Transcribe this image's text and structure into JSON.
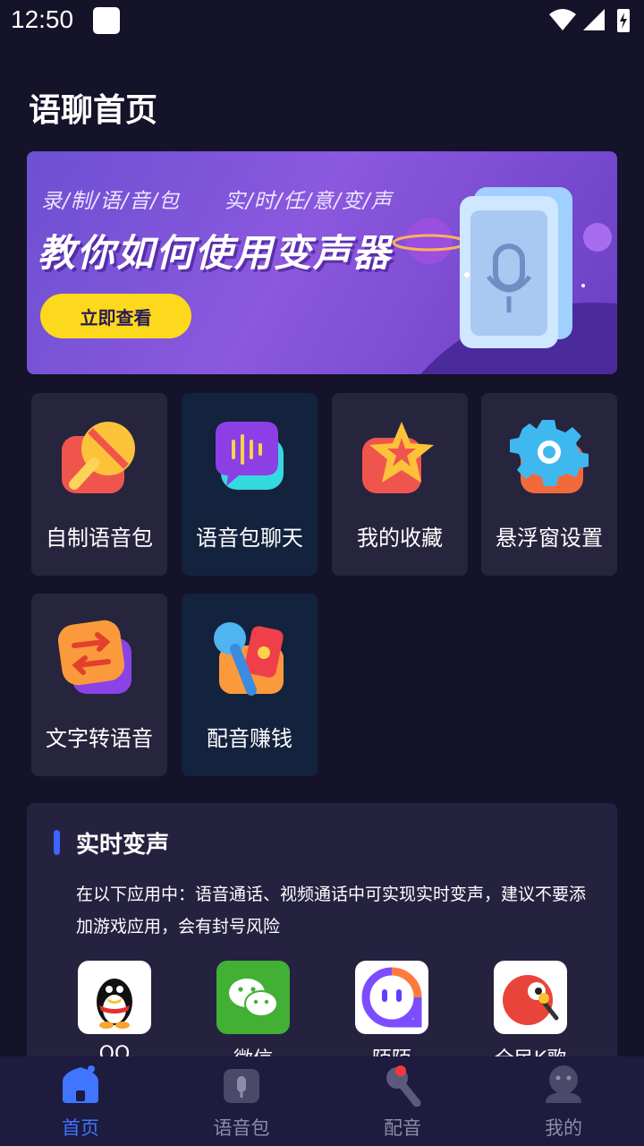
{
  "status_bar": {
    "time": "12:50"
  },
  "page": {
    "title": "语聊首页"
  },
  "banner": {
    "subtitle": "录/制/语/音/包      实/时/任/意/变/声",
    "headline": "教你如何使用变声器",
    "button_label": "立即查看"
  },
  "features": [
    {
      "label": "自制语音包",
      "icon": "microphone-icon"
    },
    {
      "label": "语音包聊天",
      "icon": "voice-chat-icon"
    },
    {
      "label": "我的收藏",
      "icon": "star-icon"
    },
    {
      "label": "悬浮窗设置",
      "icon": "gear-icon"
    },
    {
      "label": "文字转语音",
      "icon": "convert-icon"
    },
    {
      "label": "配音赚钱",
      "icon": "mic-redpacket-icon"
    }
  ],
  "realtime": {
    "title": "实时变声",
    "description": "在以下应用中：语音通话、视频通话中可实现实时变声，建议不要添加游戏应用，会有封号风险",
    "apps": [
      {
        "label": "QQ",
        "icon": "qq-penguin-icon"
      },
      {
        "label": "微信",
        "icon": "wechat-icon"
      },
      {
        "label": "陌陌",
        "icon": "momo-icon"
      },
      {
        "label": "全民K歌",
        "icon": "kge-icon"
      }
    ]
  },
  "tabs": [
    {
      "label": "首页",
      "active": true
    },
    {
      "label": "语音包",
      "active": false
    },
    {
      "label": "配音",
      "active": false
    },
    {
      "label": "我的",
      "active": false
    }
  ],
  "colors": {
    "accent": "#3f75ff",
    "button_yellow": "#fcd91c",
    "background": "#14132a"
  }
}
